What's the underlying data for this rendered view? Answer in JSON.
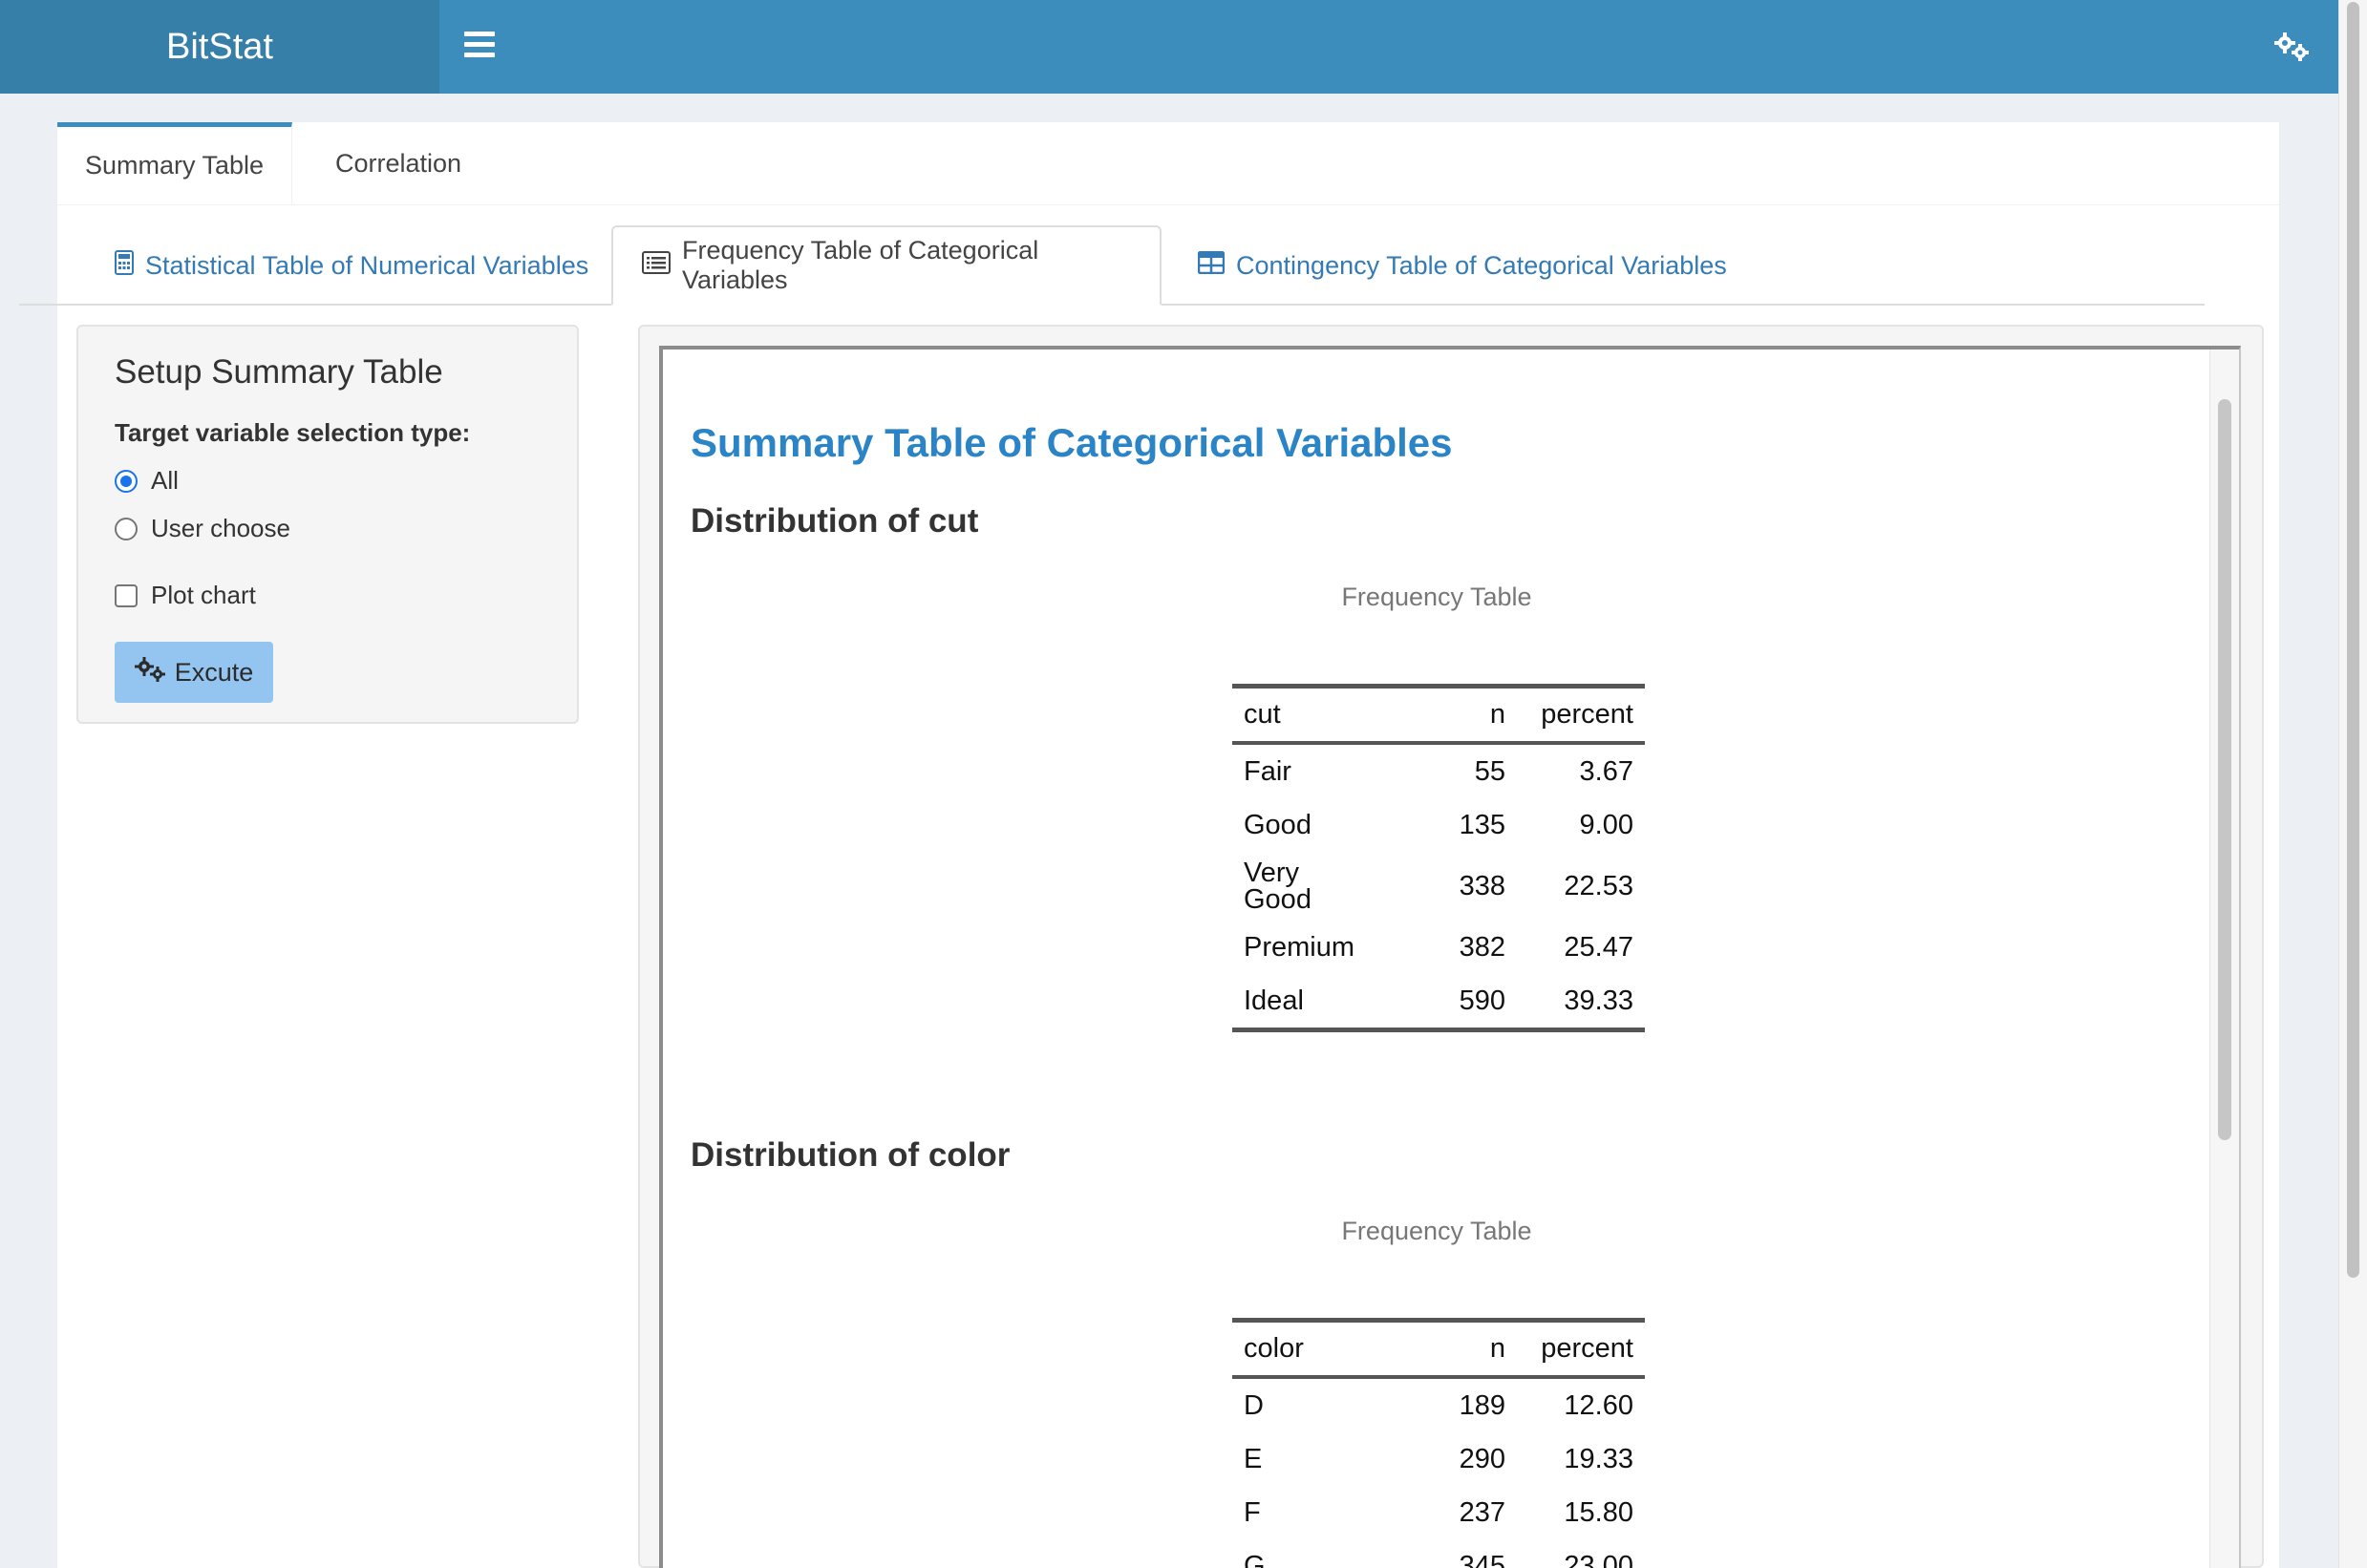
{
  "app": {
    "brand": "BitStat"
  },
  "header": {
    "menu_icon": "hamburger-icon",
    "settings_icon": "gears-icon"
  },
  "main_tabs": [
    {
      "label": "Summary Table",
      "active": true
    },
    {
      "label": "Correlation",
      "active": false
    }
  ],
  "sub_tabs": [
    {
      "label": "Statistical Table of Numerical Variables",
      "icon": "calculator-icon",
      "active": false
    },
    {
      "label": "Frequency Table of Categorical Variables",
      "icon": "list-alt-icon",
      "active": true
    },
    {
      "label": "Contingency Table of Categorical Variables",
      "icon": "table-icon",
      "active": false
    }
  ],
  "sidebar": {
    "title": "Setup Summary Table",
    "selection_label": "Target variable selection type:",
    "options": [
      {
        "label": "All",
        "checked": true
      },
      {
        "label": "User choose",
        "checked": false
      }
    ],
    "plot_chart": {
      "label": "Plot chart",
      "checked": false
    },
    "execute_button": "Excute"
  },
  "result": {
    "title": "Summary Table of Categorical Variables",
    "sections": [
      {
        "heading": "Distribution of cut",
        "caption": "Frequency Table",
        "columns": [
          "cut",
          "n",
          "percent"
        ],
        "rows": [
          [
            "Fair",
            "55",
            "3.67"
          ],
          [
            "Good",
            "135",
            "9.00"
          ],
          [
            "Very Good",
            "338",
            "22.53"
          ],
          [
            "Premium",
            "382",
            "25.47"
          ],
          [
            "Ideal",
            "590",
            "39.33"
          ]
        ]
      },
      {
        "heading": "Distribution of color",
        "caption": "Frequency Table",
        "columns": [
          "color",
          "n",
          "percent"
        ],
        "rows": [
          [
            "D",
            "189",
            "12.60"
          ],
          [
            "E",
            "290",
            "19.33"
          ],
          [
            "F",
            "237",
            "15.80"
          ],
          [
            "G",
            "345",
            "23.00"
          ]
        ]
      }
    ]
  }
}
